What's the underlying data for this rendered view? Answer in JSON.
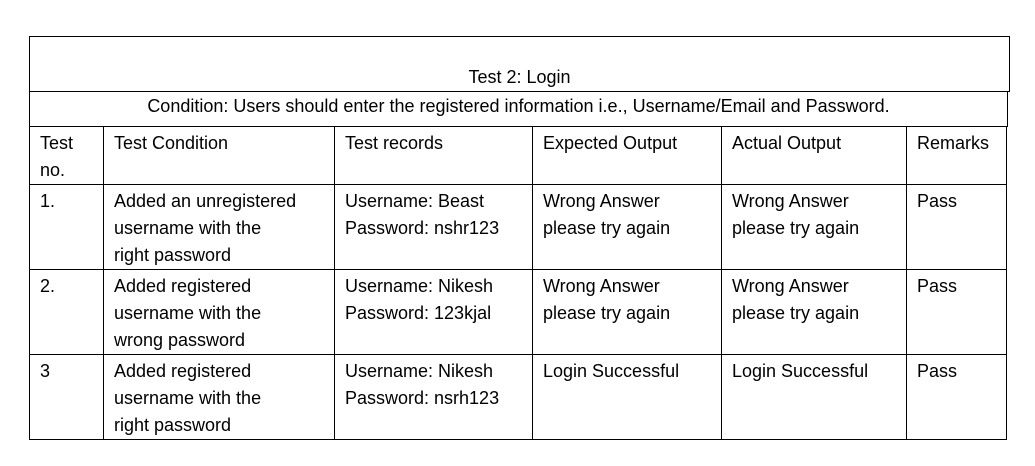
{
  "title": "Test 2: Login",
  "condition": "Condition: Users should enter the registered information i.e., Username/Email and Password.",
  "table": {
    "headers": {
      "test_no": [
        "Test",
        "no."
      ],
      "test_condition": "Test Condition",
      "test_records": "Test records",
      "expected_output": "Expected Output",
      "actual_output": "Actual Output",
      "remarks": "Remarks"
    },
    "rows": [
      {
        "no": "1.",
        "condition": [
          "Added an unregistered",
          "username with the",
          "right password"
        ],
        "records": [
          "Username: Beast",
          "Password: nshr123"
        ],
        "expected": [
          "Wrong Answer",
          "please try again"
        ],
        "actual": [
          "Wrong Answer",
          "please try again"
        ],
        "remarks": "Pass"
      },
      {
        "no": "2.",
        "condition": [
          "Added registered",
          "username with the",
          "wrong password"
        ],
        "records": [
          "Username: Nikesh",
          "Password: 123kjal"
        ],
        "expected": [
          "Wrong Answer",
          "please try again"
        ],
        "actual": [
          "Wrong Answer",
          "please try again"
        ],
        "remarks": "Pass"
      },
      {
        "no": "3",
        "condition": [
          "Added registered",
          "username with the",
          "right password"
        ],
        "records": [
          "Username: Nikesh",
          "Password: nsrh123"
        ],
        "expected": [
          "Login Successful"
        ],
        "actual": [
          "Login Successful"
        ],
        "remarks": "Pass"
      }
    ]
  }
}
